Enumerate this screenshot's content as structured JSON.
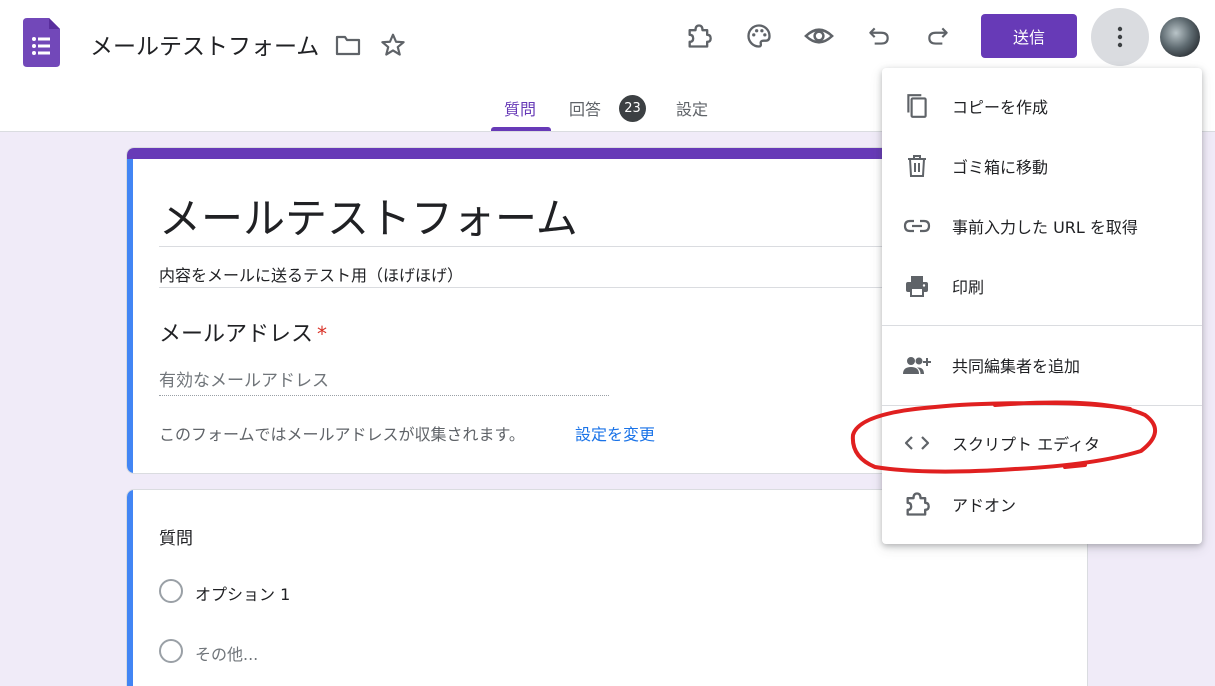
{
  "header": {
    "doc_title": "メールテストフォーム",
    "send_label": "送信",
    "tabs": [
      {
        "label": "質問"
      },
      {
        "label": "回答"
      },
      {
        "label": "設定"
      }
    ],
    "responses_count": "23"
  },
  "form": {
    "title": "メールテストフォーム",
    "description": "内容をメールに送るテスト用（ほげほげ）",
    "email_label": "メールアドレス",
    "required_mark": "*",
    "email_placeholder": "有効なメールアドレス",
    "collect_note": "このフォームではメールアドレスが収集されます。",
    "change_settings_link": "設定を変更"
  },
  "question": {
    "title": "質問",
    "options": [
      "オプション 1",
      "その他..."
    ]
  },
  "menu": {
    "items": [
      {
        "label": "コピーを作成",
        "icon": "copy-icon"
      },
      {
        "label": "ゴミ箱に移動",
        "icon": "trash-icon"
      },
      {
        "label": "事前入力した URL を取得",
        "icon": "link-icon"
      },
      {
        "label": "印刷",
        "icon": "print-icon"
      },
      {
        "label": "共同編集者を追加",
        "icon": "add-collaborator-icon"
      },
      {
        "label": "スクリプト エディタ",
        "icon": "code-icon"
      },
      {
        "label": "アドオン",
        "icon": "puzzle-icon"
      }
    ]
  },
  "colors": {
    "accent": "#673ab7",
    "background": "#f0ebf8",
    "question_accent": "#4285f4",
    "annotation": "#e02020"
  }
}
